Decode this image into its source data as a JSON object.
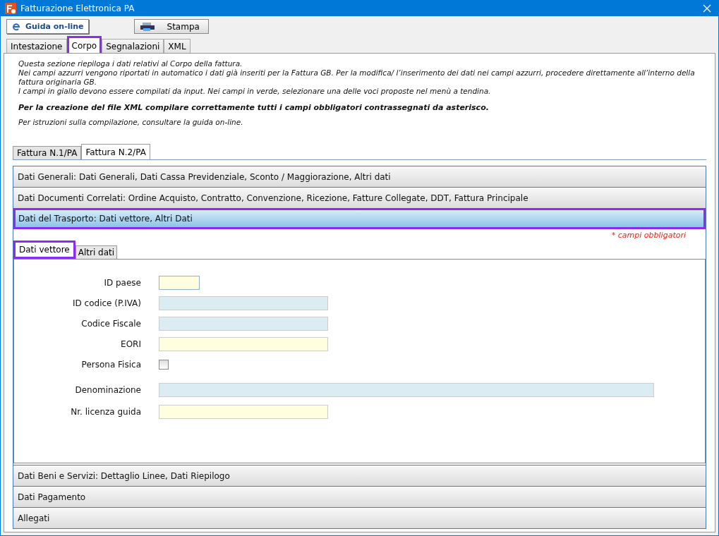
{
  "window": {
    "title": "Fatturazione Elettronica PA"
  },
  "toolbar": [
    {
      "label": "Guida on-line",
      "kind": "help"
    },
    {
      "label": "Stampa",
      "kind": "print"
    }
  ],
  "tabs": [
    {
      "label": "Intestazione",
      "selected": false
    },
    {
      "label": "Corpo",
      "selected": true
    },
    {
      "label": "Segnalazioni",
      "selected": false
    },
    {
      "label": "XML",
      "selected": false
    }
  ],
  "intro": {
    "lines": [
      "Questa sezione riepiloga i dati relativi al Corpo della fattura.",
      "Nei campi azzurri vengono riportati in automatico i dati già inseriti per la Fattura GB. Per la modifica/ l’inserimento dei dati nei campi azzurri, procedere direttamente all’interno della fattura originaria GB.",
      "I campi in giallo devono essere compilati da input. Nei campi in verde, selezionare una delle voci proposte nel menù a tendina."
    ],
    "notice": "Per la creazione del file XML compilare correttamente tutti i campi obbligatori contrassegnati da asterisco.",
    "help": "Per istruzioni sulla compilazione, consultare la guida on-line."
  },
  "invoice_tabs": [
    {
      "label": "Fattura N.1/PA",
      "selected": false
    },
    {
      "label": "Fattura N.2/PA",
      "selected": true
    }
  ],
  "sections": [
    {
      "title": "Dati Generali: Dati Generali, Dati Cassa Previdenziale, Sconto / Maggiorazione, Altri dati",
      "expanded": false
    },
    {
      "title": "Dati Documenti Correlati: Ordine Acquisto, Contratto, Convenzione, Ricezione, Fatture Collegate, DDT, Fattura Principale",
      "expanded": false
    },
    {
      "title": "Dati del Trasporto: Dati vettore, Altri Dati",
      "expanded": true,
      "required_note": "* campi obbligatori",
      "tabs": [
        {
          "label": "Dati vettore",
          "selected": true
        },
        {
          "label": "Altri dati",
          "selected": false
        }
      ],
      "fields": [
        {
          "label": "ID paese",
          "kind": "input"
        },
        {
          "label": "ID codice (P.IVA)",
          "kind": "auto"
        },
        {
          "label": "Codice Fiscale",
          "kind": "auto"
        },
        {
          "label": "EORI",
          "kind": "input"
        },
        {
          "label": "Persona Fisica",
          "kind": "checkbox",
          "checked": false
        },
        {
          "label": "Denominazione",
          "kind": "auto"
        },
        {
          "label": "Nr. licenza guida",
          "kind": "input"
        }
      ]
    },
    {
      "title": "Dati Beni e Servizi: Dettaglio Linee, Dati Riepilogo",
      "expanded": false
    },
    {
      "title": "Dati Pagamento",
      "expanded": false
    },
    {
      "title": "Allegati",
      "expanded": false
    }
  ]
}
